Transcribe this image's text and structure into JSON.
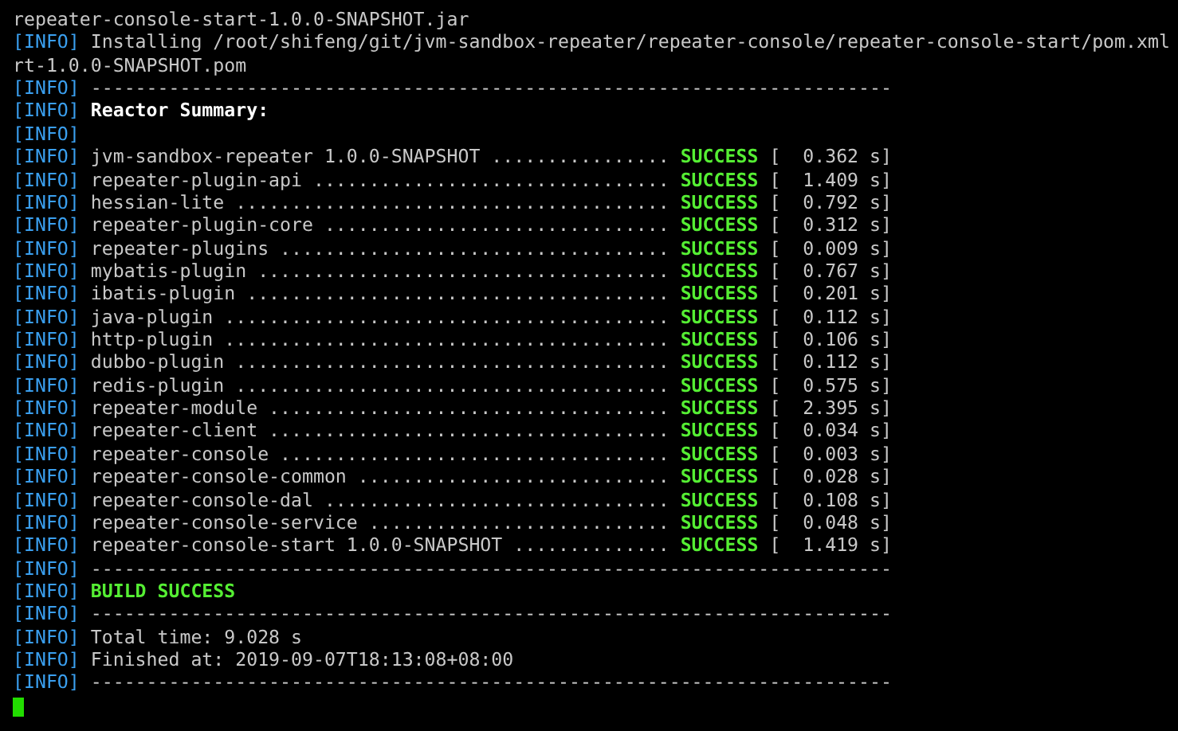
{
  "terminal": {
    "lines": [
      {
        "kind": "plain",
        "text": "repeater-console-start-1.0.0-SNAPSHOT.jar"
      },
      {
        "kind": "info",
        "tag": "[INFO]",
        "text": "Installing /root/shifeng/git/jvm-sandbox-repeater/repeater-console/repeater-console-start/pom.xml"
      },
      {
        "kind": "plain",
        "text": "rt-1.0.0-SNAPSHOT.pom"
      },
      {
        "kind": "info",
        "tag": "[INFO]",
        "text": "------------------------------------------------------------------------"
      },
      {
        "kind": "heading",
        "tag": "[INFO]",
        "text": "Reactor Summary:"
      },
      {
        "kind": "info",
        "tag": "[INFO]"
      },
      {
        "kind": "module",
        "tag": "[INFO]",
        "text": "jvm-sandbox-repeater 1.0.0-SNAPSHOT ................ ",
        "status": "SUCCESS",
        "time": "[  0.362 s]"
      },
      {
        "kind": "module",
        "tag": "[INFO]",
        "text": "repeater-plugin-api ................................ ",
        "status": "SUCCESS",
        "time": "[  1.409 s]"
      },
      {
        "kind": "module",
        "tag": "[INFO]",
        "text": "hessian-lite ....................................... ",
        "status": "SUCCESS",
        "time": "[  0.792 s]"
      },
      {
        "kind": "module",
        "tag": "[INFO]",
        "text": "repeater-plugin-core ............................... ",
        "status": "SUCCESS",
        "time": "[  0.312 s]"
      },
      {
        "kind": "module",
        "tag": "[INFO]",
        "text": "repeater-plugins ................................... ",
        "status": "SUCCESS",
        "time": "[  0.009 s]"
      },
      {
        "kind": "module",
        "tag": "[INFO]",
        "text": "mybatis-plugin ..................................... ",
        "status": "SUCCESS",
        "time": "[  0.767 s]"
      },
      {
        "kind": "module",
        "tag": "[INFO]",
        "text": "ibatis-plugin ...................................... ",
        "status": "SUCCESS",
        "time": "[  0.201 s]"
      },
      {
        "kind": "module",
        "tag": "[INFO]",
        "text": "java-plugin ........................................ ",
        "status": "SUCCESS",
        "time": "[  0.112 s]"
      },
      {
        "kind": "module",
        "tag": "[INFO]",
        "text": "http-plugin ........................................ ",
        "status": "SUCCESS",
        "time": "[  0.106 s]"
      },
      {
        "kind": "module",
        "tag": "[INFO]",
        "text": "dubbo-plugin ....................................... ",
        "status": "SUCCESS",
        "time": "[  0.112 s]"
      },
      {
        "kind": "module",
        "tag": "[INFO]",
        "text": "redis-plugin ....................................... ",
        "status": "SUCCESS",
        "time": "[  0.575 s]"
      },
      {
        "kind": "module",
        "tag": "[INFO]",
        "text": "repeater-module .................................... ",
        "status": "SUCCESS",
        "time": "[  2.395 s]"
      },
      {
        "kind": "module",
        "tag": "[INFO]",
        "text": "repeater-client .................................... ",
        "status": "SUCCESS",
        "time": "[  0.034 s]"
      },
      {
        "kind": "module",
        "tag": "[INFO]",
        "text": "repeater-console ................................... ",
        "status": "SUCCESS",
        "time": "[  0.003 s]"
      },
      {
        "kind": "module",
        "tag": "[INFO]",
        "text": "repeater-console-common ............................ ",
        "status": "SUCCESS",
        "time": "[  0.028 s]"
      },
      {
        "kind": "module",
        "tag": "[INFO]",
        "text": "repeater-console-dal ............................... ",
        "status": "SUCCESS",
        "time": "[  0.108 s]"
      },
      {
        "kind": "module",
        "tag": "[INFO]",
        "text": "repeater-console-service ........................... ",
        "status": "SUCCESS",
        "time": "[  0.048 s]"
      },
      {
        "kind": "module",
        "tag": "[INFO]",
        "text": "repeater-console-start 1.0.0-SNAPSHOT .............. ",
        "status": "SUCCESS",
        "time": "[  1.419 s]"
      },
      {
        "kind": "info",
        "tag": "[INFO]",
        "text": "------------------------------------------------------------------------"
      },
      {
        "kind": "success",
        "tag": "[INFO]",
        "text": "BUILD SUCCESS"
      },
      {
        "kind": "info",
        "tag": "[INFO]",
        "text": "------------------------------------------------------------------------"
      },
      {
        "kind": "info",
        "tag": "[INFO]",
        "text": "Total time: 9.028 s"
      },
      {
        "kind": "info",
        "tag": "[INFO]",
        "text": "Finished at: 2019-09-07T18:13:08+08:00"
      },
      {
        "kind": "info",
        "tag": "[INFO]",
        "text": "------------------------------------------------------------------------"
      },
      {
        "kind": "cursor"
      }
    ]
  }
}
